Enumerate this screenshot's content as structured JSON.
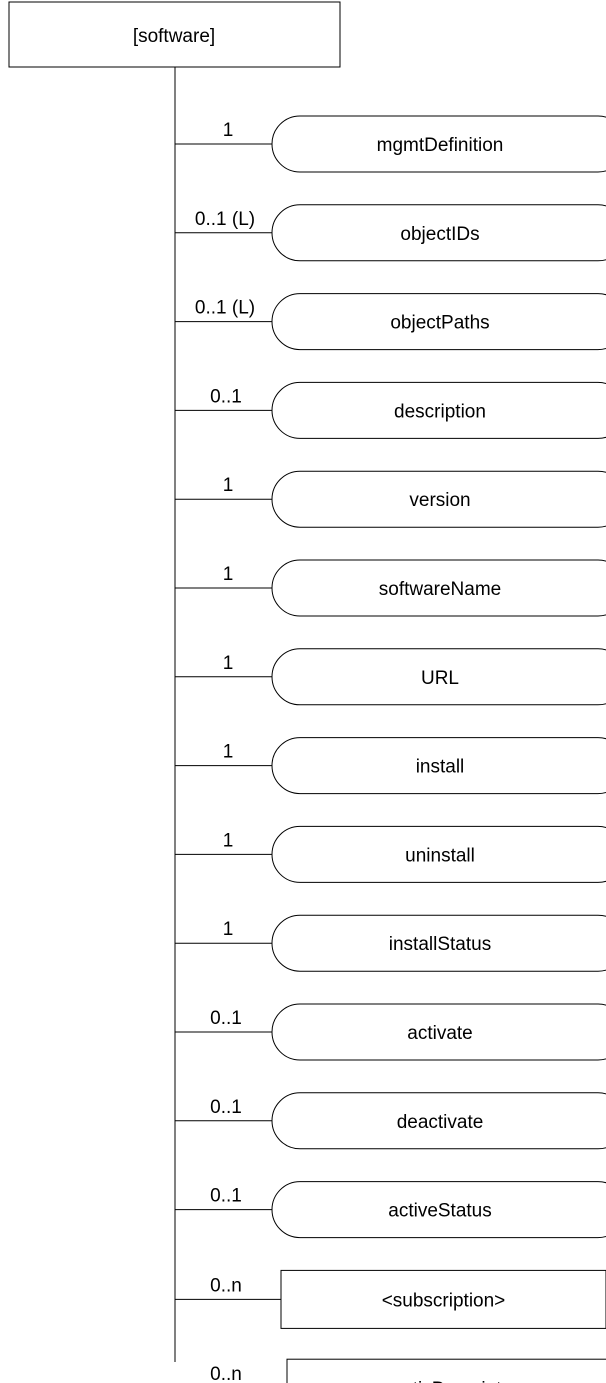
{
  "root": {
    "label": "[software]"
  },
  "children": [
    {
      "label": "mgmtDefinition",
      "multiplicity": "1",
      "shape": "rounded"
    },
    {
      "label": "objectIDs",
      "multiplicity": "0..1 (L)",
      "shape": "rounded"
    },
    {
      "label": "objectPaths",
      "multiplicity": "0..1 (L)",
      "shape": "rounded"
    },
    {
      "label": "description",
      "multiplicity": "0..1",
      "shape": "rounded"
    },
    {
      "label": "version",
      "multiplicity": "1",
      "shape": "rounded"
    },
    {
      "label": "softwareName",
      "multiplicity": "1",
      "shape": "rounded"
    },
    {
      "label": "URL",
      "multiplicity": "1",
      "shape": "rounded"
    },
    {
      "label": "install",
      "multiplicity": "1",
      "shape": "rounded"
    },
    {
      "label": "uninstall",
      "multiplicity": "1",
      "shape": "rounded"
    },
    {
      "label": "installStatus",
      "multiplicity": "1",
      "shape": "rounded"
    },
    {
      "label": "activate",
      "multiplicity": "0..1",
      "shape": "rounded"
    },
    {
      "label": "deactivate",
      "multiplicity": "0..1",
      "shape": "rounded"
    },
    {
      "label": "activeStatus",
      "multiplicity": "0..1",
      "shape": "rounded"
    },
    {
      "label": "<subscription>",
      "multiplicity": "0..n",
      "shape": "rect"
    },
    {
      "label": "<semanticDescriptor>",
      "multiplicity": "0..n",
      "shape": "rect"
    }
  ]
}
